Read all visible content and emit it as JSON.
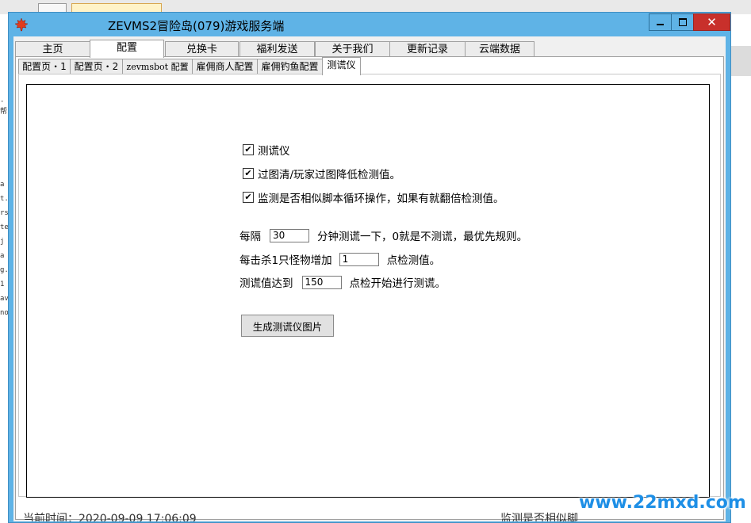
{
  "window": {
    "title": "ZEVMS2冒险岛(079)游戏服务端",
    "close_glyph": "✕"
  },
  "main_tabs": [
    "主页",
    "配置",
    "兑换卡",
    "福利发送",
    "关于我们",
    "更新记录",
    "云端数据"
  ],
  "main_tabs_active": "配置",
  "sub_tabs": [
    "配置页・1",
    "配置页・2",
    "zevmsbot 配置",
    "雇佣商人配置",
    "雇佣钓鱼配置",
    "测谎仪"
  ],
  "sub_tabs_active": "测谎仪",
  "checkboxes": [
    {
      "label": "测谎仪",
      "checked": true
    },
    {
      "label": "过图清/玩家过图降低检测值。",
      "checked": true
    },
    {
      "label": "监测是否相似脚本循环操作，如果有就翻倍检测值。",
      "checked": true
    }
  ],
  "check_glyph": "✔",
  "settings": {
    "interval_prefix": "每隔",
    "interval_value": "30",
    "interval_suffix": "分钟测谎一下，0就是不测谎，最优先规则。",
    "kill_prefix": "每击杀1只怪物增加",
    "kill_value": "1",
    "kill_suffix": "点检测值。",
    "threshold_prefix": "测谎值达到",
    "threshold_value": "150",
    "threshold_suffix": "点检开始进行测谎。"
  },
  "generate_button": "生成测谎仪图片",
  "status": {
    "left": "当前时间：2020-09-09 17:06:09",
    "right": "监测是否相似脚"
  },
  "watermark": "www.22mxd.com",
  "colors": {
    "title_bar": "#5fb3e6",
    "close_button": "#c8302b",
    "watermark": "#1e8fe6"
  }
}
